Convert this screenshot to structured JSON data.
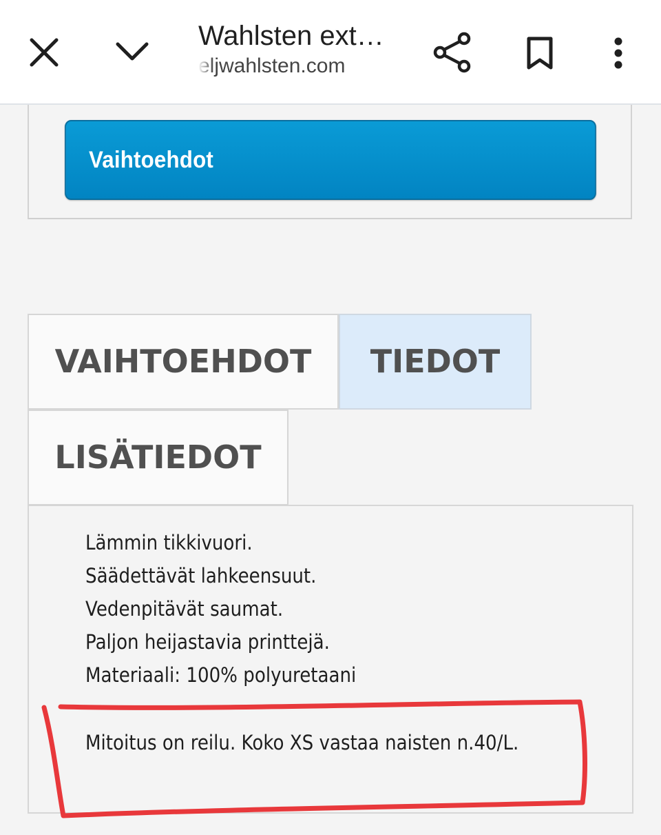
{
  "browser": {
    "page_title": "Wahlsten ext…",
    "url": "eljwahlsten.com",
    "icons": [
      "close-icon",
      "chevron-down-icon",
      "share-icon",
      "bookmark-icon",
      "more-vert-icon"
    ]
  },
  "options": {
    "button_label": "Vaihtoehdot",
    "button_color": "#0290cc"
  },
  "tabs": [
    {
      "label": "VAIHTOEHDOT",
      "active": false
    },
    {
      "label": "TIEDOT",
      "active": true
    },
    {
      "label": "LISÄTIEDOT",
      "active": false
    }
  ],
  "description": {
    "lines": [
      "Lämmin tikkivuori.",
      "Säädettävät lahkeensuut.",
      "Vedenpitävät saumat.",
      "Paljon heijastavia printtejä.",
      "Materiaali: 100% polyuretaani"
    ],
    "sizing_note": "Mitoitus on reilu. Koko XS vastaa naisten n.40/L."
  },
  "annotation": {
    "color": "#e8383b"
  }
}
